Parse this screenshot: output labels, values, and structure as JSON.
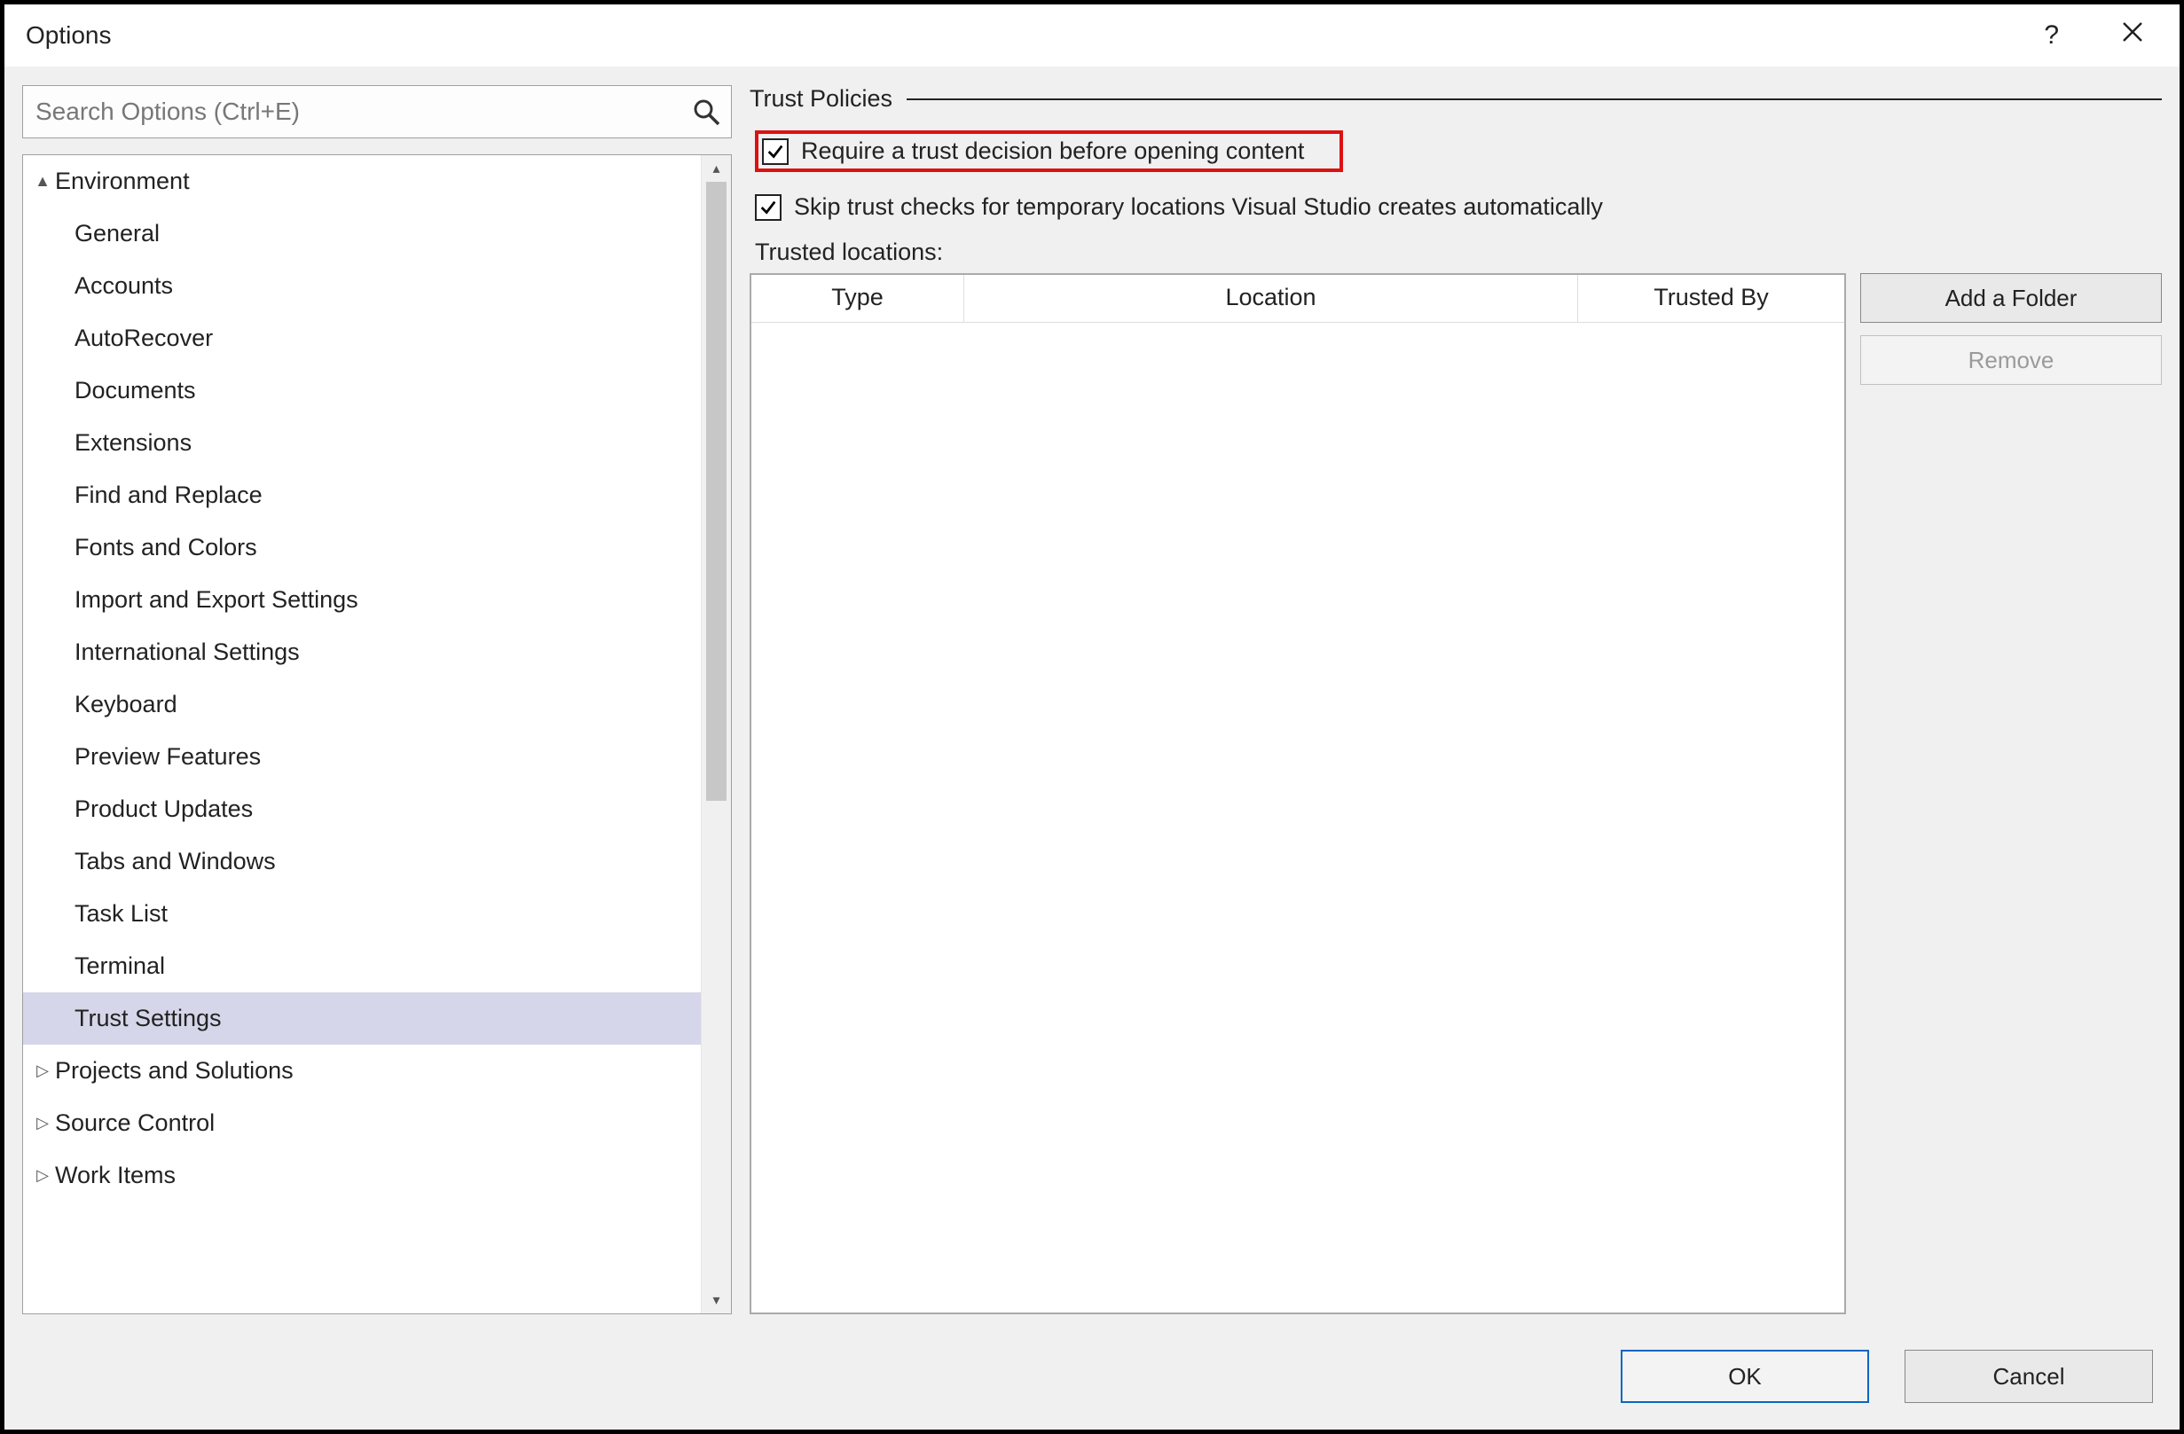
{
  "window": {
    "title": "Options"
  },
  "search": {
    "placeholder": "Search Options (Ctrl+E)"
  },
  "tree": {
    "env": {
      "label": "Environment",
      "expanded": true
    },
    "general": "General",
    "accounts": "Accounts",
    "autorec": "AutoRecover",
    "documents": "Documents",
    "extensions": "Extensions",
    "findrepl": "Find and Replace",
    "fonts": "Fonts and Colors",
    "impexp": "Import and Export Settings",
    "intl": "International Settings",
    "keyboard": "Keyboard",
    "preview": "Preview Features",
    "updates": "Product Updates",
    "tabs": "Tabs and Windows",
    "tasklist": "Task List",
    "terminal": "Terminal",
    "trust": "Trust Settings",
    "projsol": "Projects and Solutions",
    "srcctrl": "Source Control",
    "workitems": "Work Items"
  },
  "policies": {
    "group_label": "Trust Policies",
    "require": {
      "label": "Require a trust decision before opening content",
      "checked": true
    },
    "skip_temp": {
      "label": "Skip trust checks for temporary locations Visual Studio creates automatically",
      "checked": true
    },
    "trusted_locations_label": "Trusted locations:",
    "columns": {
      "type": "Type",
      "location": "Location",
      "trusted_by": "Trusted By"
    },
    "rows": []
  },
  "buttons": {
    "add_folder": "Add a Folder",
    "remove": "Remove",
    "ok": "OK",
    "cancel": "Cancel"
  }
}
